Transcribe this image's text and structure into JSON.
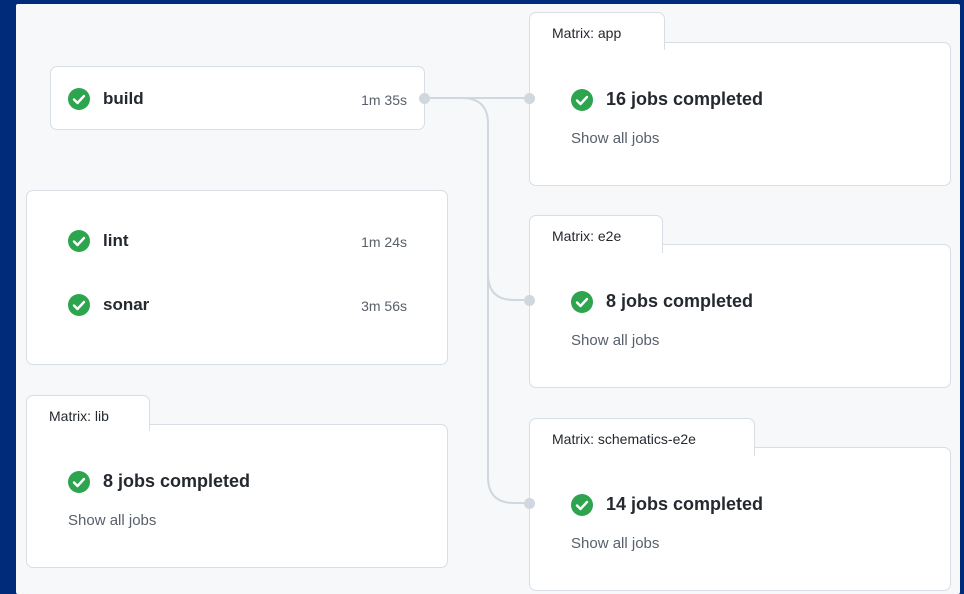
{
  "colors": {
    "success": "#2da44e",
    "connector": "#d0d7de"
  },
  "icons": {
    "status": "check-circle-icon"
  },
  "jobs": {
    "build": {
      "name": "build",
      "duration": "1m 35s"
    },
    "lint": {
      "name": "lint",
      "duration": "1m 24s"
    },
    "sonar": {
      "name": "sonar",
      "duration": "3m 56s"
    }
  },
  "matrices": {
    "lib": {
      "title": "Matrix: lib",
      "summary": "8 jobs completed",
      "link": "Show all jobs"
    },
    "app": {
      "title": "Matrix: app",
      "summary": "16 jobs completed",
      "link": "Show all jobs"
    },
    "e2e": {
      "title": "Matrix: e2e",
      "summary": "8 jobs completed",
      "link": "Show all jobs"
    },
    "schematics": {
      "title": "Matrix: schematics-e2e",
      "summary": "14 jobs completed",
      "link": "Show all jobs"
    }
  }
}
